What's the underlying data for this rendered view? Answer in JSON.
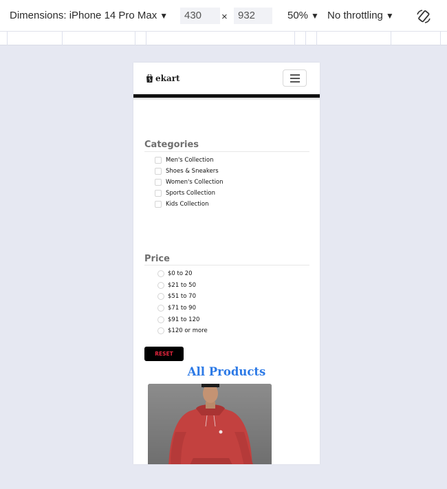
{
  "devtools": {
    "device_label": "Dimensions: iPhone 14 Pro Max",
    "width": "430",
    "separator": "×",
    "height": "932",
    "zoom": "50%",
    "throttle": "No throttling",
    "caret": "▼"
  },
  "site": {
    "brand": "ekart",
    "categories_title": "Categories",
    "categories": [
      "Men's Collection",
      "Shoes & Sneakers",
      "Women's Collection",
      "Sports Collection",
      "Kids Collection"
    ],
    "price_title": "Price",
    "prices": [
      "$0 to 20",
      "$21 to 50",
      "$51 to 70",
      "$71 to 90",
      "$91 to 120",
      "$120 or more"
    ],
    "reset_label": "RESET",
    "products_title": "All Products"
  },
  "colors": {
    "accent_blue": "#2d7ae6",
    "reset_text": "#e3253d",
    "hoodie_red": "#c3413f"
  }
}
